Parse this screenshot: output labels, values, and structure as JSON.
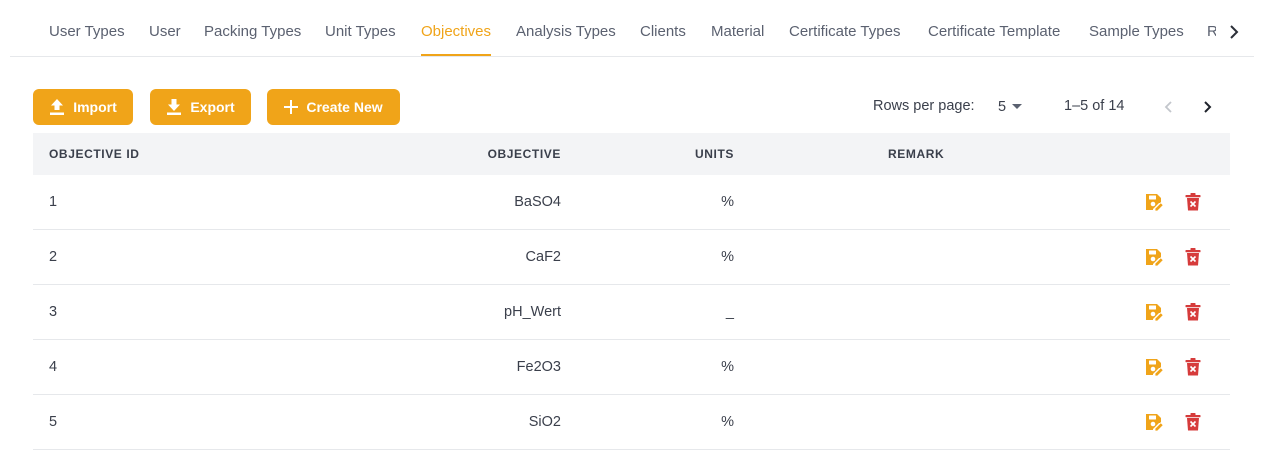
{
  "tabs": [
    {
      "label": "User Types",
      "active": false
    },
    {
      "label": "User",
      "active": false
    },
    {
      "label": "Packing Types",
      "active": false
    },
    {
      "label": "Unit Types",
      "active": false
    },
    {
      "label": "Objectives",
      "active": true
    },
    {
      "label": "Analysis Types",
      "active": false
    },
    {
      "label": "Clients",
      "active": false
    },
    {
      "label": "Material",
      "active": false
    },
    {
      "label": "Certificate Types",
      "active": false
    },
    {
      "label": "Certificate Template",
      "active": false
    },
    {
      "label": "Sample Types",
      "active": false
    },
    {
      "label": "R",
      "active": false
    }
  ],
  "toolbar": {
    "import_label": "Import",
    "export_label": "Export",
    "create_label": "Create New"
  },
  "pagination": {
    "rows_per_page_label": "Rows per page:",
    "rows_per_page": "5",
    "range": "1–5 of 14"
  },
  "table": {
    "headers": {
      "id": "OBJECTIVE ID",
      "objective": "OBJECTIVE",
      "units": "UNITS",
      "remark": "REMARK"
    },
    "rows": [
      {
        "id": "1",
        "objective": "BaSO4",
        "units": "%",
        "remark": ""
      },
      {
        "id": "2",
        "objective": "CaF2",
        "units": "%",
        "remark": ""
      },
      {
        "id": "3",
        "objective": "pH_Wert",
        "units": "_",
        "remark": ""
      },
      {
        "id": "4",
        "objective": "Fe2O3",
        "units": "%",
        "remark": ""
      },
      {
        "id": "5",
        "objective": "SiO2",
        "units": "%",
        "remark": ""
      }
    ]
  },
  "colors": {
    "accent": "#f0a419",
    "delete": "#d63b3b"
  }
}
